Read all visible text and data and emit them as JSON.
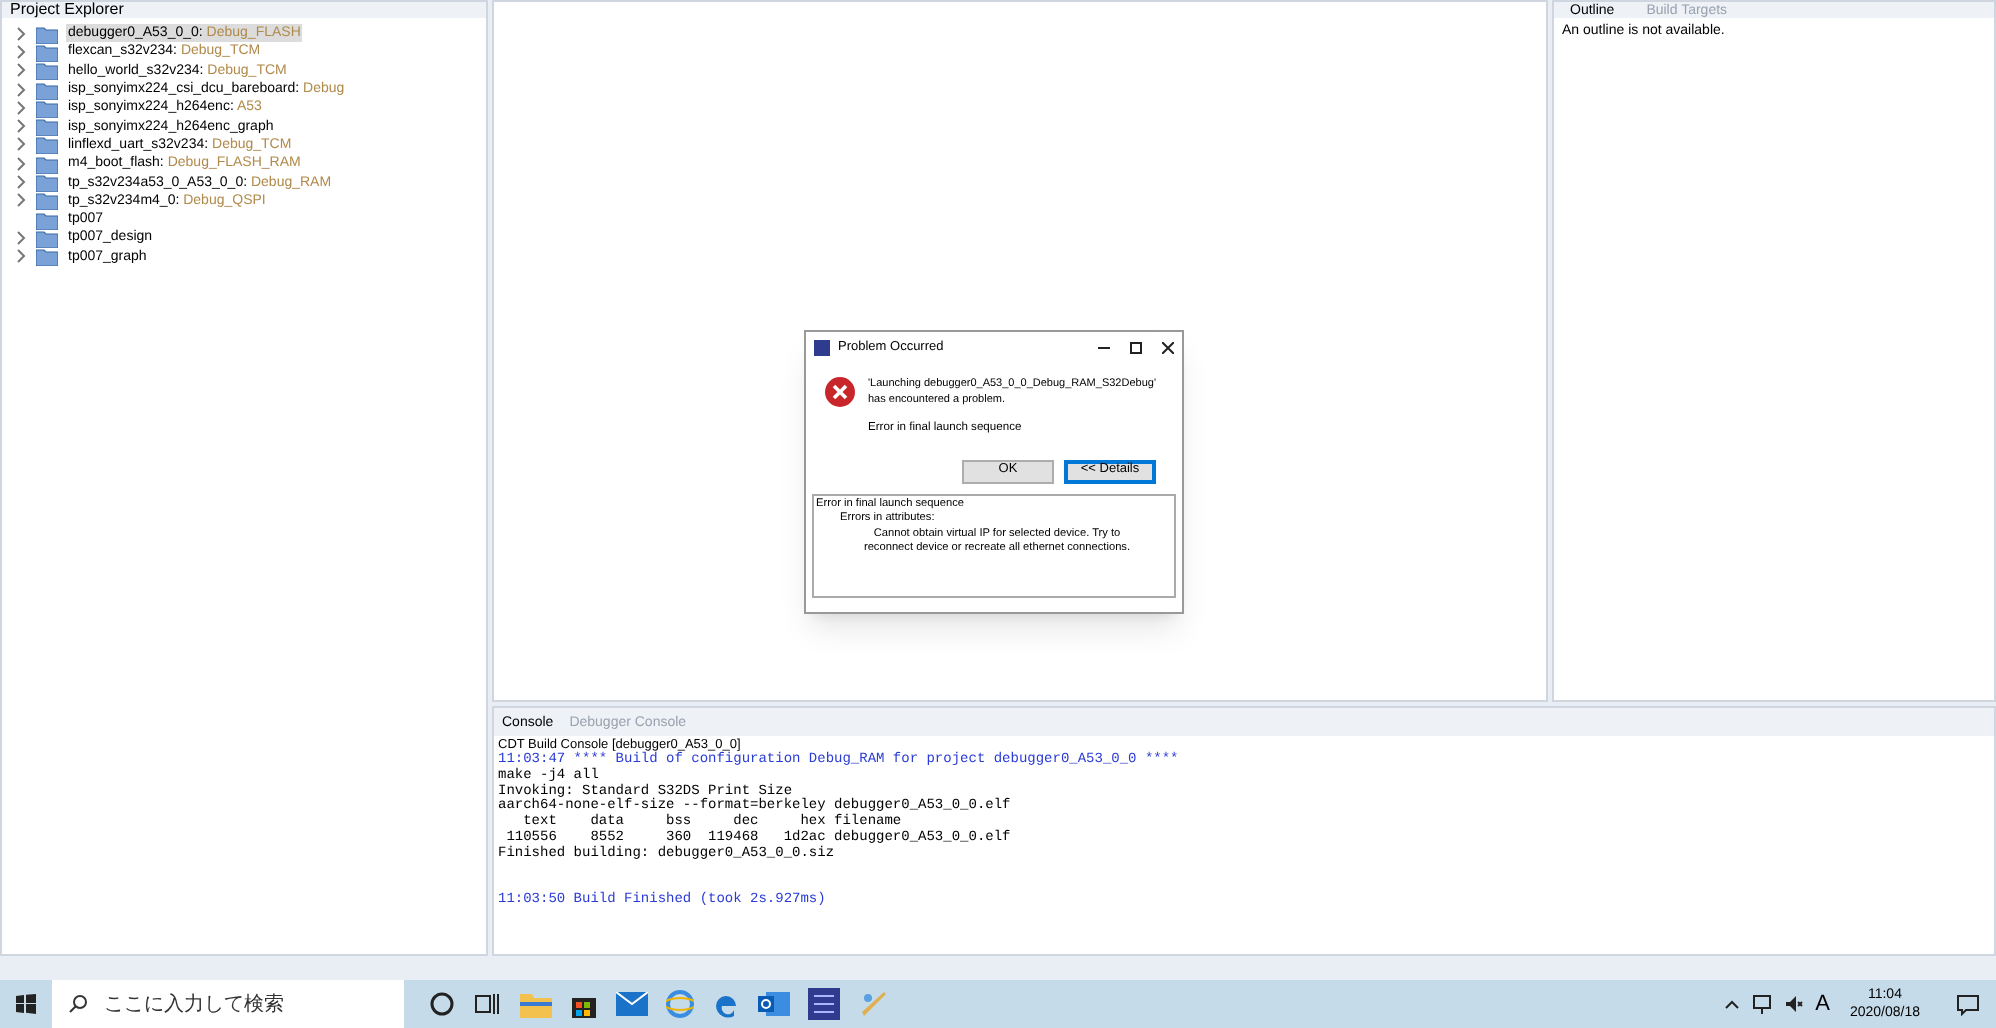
{
  "project_explorer": {
    "title": "Project Explorer",
    "projects": [
      {
        "name": "debugger0_A53_0_0:",
        "config": "Debug_FLASH",
        "expandable": true,
        "selected": true
      },
      {
        "name": "flexcan_s32v234:",
        "config": "Debug_TCM",
        "expandable": true,
        "selected": false
      },
      {
        "name": "hello_world_s32v234:",
        "config": "Debug_TCM",
        "expandable": true,
        "selected": false
      },
      {
        "name": "isp_sonyimx224_csi_dcu_bareboard:",
        "config": "Debug",
        "expandable": true,
        "selected": false
      },
      {
        "name": "isp_sonyimx224_h264enc:",
        "config": "A53",
        "expandable": true,
        "selected": false
      },
      {
        "name": "isp_sonyimx224_h264enc_graph",
        "expandable": true,
        "selected": false
      },
      {
        "name": "linflexd_uart_s32v234:",
        "config": "Debug_TCM",
        "expandable": true,
        "selected": false
      },
      {
        "name": "m4_boot_flash:",
        "config": "Debug_FLASH_RAM",
        "expandable": true,
        "selected": false
      },
      {
        "name": "tp_s32v234a53_0_A53_0_0:",
        "config": "Debug_RAM",
        "expandable": true,
        "selected": false
      },
      {
        "name": "tp_s32v234m4_0:",
        "config": "Debug_QSPI",
        "expandable": true,
        "selected": false
      },
      {
        "name": "tp007",
        "expandable": false,
        "selected": false
      },
      {
        "name": "tp007_design",
        "expandable": true,
        "selected": false
      },
      {
        "name": "tp007_graph",
        "expandable": true,
        "selected": false
      }
    ]
  },
  "outline": {
    "tabs": [
      {
        "label": "Outline",
        "selected": true
      },
      {
        "label": "Build Targets",
        "selected": false
      }
    ],
    "message": "An outline is not available."
  },
  "console": {
    "tabs": [
      {
        "label": "Console",
        "selected": true
      },
      {
        "label": "Debugger Console",
        "selected": false
      }
    ],
    "header": "CDT Build Console [debugger0_A53_0_0]",
    "lines": [
      {
        "kind": "info",
        "text": "11:03:47 **** Build of configuration Debug_RAM for project debugger0_A53_0_0 ****"
      },
      {
        "kind": "plain",
        "text": "make -j4 all"
      },
      {
        "kind": "plain",
        "text": "Invoking: Standard S32DS Print Size"
      },
      {
        "kind": "plain",
        "text": "aarch64-none-elf-size --format=berkeley debugger0_A53_0_0.elf"
      },
      {
        "kind": "plain",
        "text": "   text    data     bss     dec     hex filename"
      },
      {
        "kind": "plain",
        "text": " 110556    8552     360  119468   1d2ac debugger0_A53_0_0.elf"
      },
      {
        "kind": "plain",
        "text": "Finished building: debugger0_A53_0_0.siz"
      },
      {
        "kind": "blank"
      },
      {
        "kind": "blank"
      },
      {
        "kind": "info",
        "text": "11:03:50 Build Finished (took 2s.927ms)"
      }
    ]
  },
  "dialog": {
    "title": "Problem Occurred",
    "message": "'Launching debugger0_A53_0_0_Debug_RAM_S32Debug' has encountered a problem.",
    "reason": "Error in final launch sequence",
    "buttons": [
      {
        "label": "OK",
        "selected": false
      },
      {
        "label": "<< Details",
        "selected": true
      }
    ],
    "details": [
      {
        "text": "Error in final launch sequence",
        "children": [
          {
            "text": "Errors in attributes:",
            "children": [
              {
                "text": "Cannot obtain virtual IP for selected device. Try to reconnect device or recreate all ethernet connections."
              }
            ]
          }
        ]
      }
    ]
  },
  "taskbar": {
    "search_placeholder": "ここに入力して検索",
    "ime": "A",
    "time": "11:04",
    "date": "2020/08/18"
  }
}
